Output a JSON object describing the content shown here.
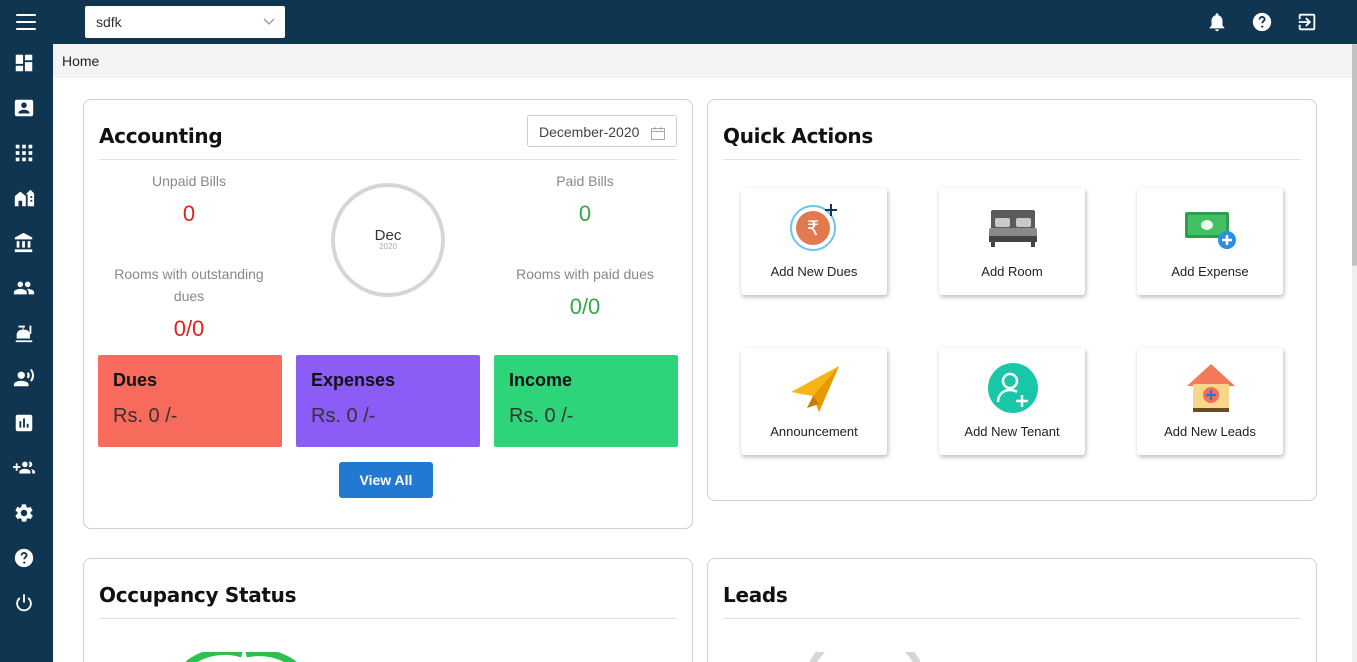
{
  "header": {
    "property_select": {
      "value": "sdfk"
    },
    "icons": [
      "menu-icon",
      "bell-icon",
      "help-icon",
      "logout-icon"
    ]
  },
  "sidebar": {
    "items": [
      {
        "icon": "dashboard-icon"
      },
      {
        "icon": "contact-card-icon"
      },
      {
        "icon": "apps-grid-icon"
      },
      {
        "icon": "building-icon"
      },
      {
        "icon": "bank-icon"
      },
      {
        "icon": "people-icon"
      },
      {
        "icon": "restaurant-icon"
      },
      {
        "icon": "voice-person-icon"
      },
      {
        "icon": "bar-chart-icon"
      },
      {
        "icon": "group-add-icon"
      },
      {
        "icon": "gear-icon"
      },
      {
        "icon": "help-icon"
      },
      {
        "icon": "power-icon"
      }
    ]
  },
  "breadcrumb": {
    "label": "Home"
  },
  "accounting": {
    "title": "Accounting",
    "month_picker": {
      "value": "December-2020"
    },
    "unpaid_bills": {
      "label": "Unpaid Bills",
      "value": "0"
    },
    "paid_bills": {
      "label": "Paid Bills",
      "value": "0"
    },
    "rooms_outstanding": {
      "label": "Rooms with outstanding dues",
      "value": "0/0"
    },
    "rooms_paid": {
      "label": "Rooms with paid dues",
      "value": "0/0"
    },
    "donut": {
      "month": "Dec",
      "year": "2020"
    },
    "boxes": [
      {
        "title": "Dues",
        "amount": "Rs. 0 /-",
        "color": "#f76a5c"
      },
      {
        "title": "Expenses",
        "amount": "Rs. 0 /-",
        "color": "#8b5cf6"
      },
      {
        "title": "Income",
        "amount": "Rs. 0 /-",
        "color": "#2ed47a"
      }
    ],
    "view_all_label": "View All"
  },
  "quick_actions": {
    "title": "Quick Actions",
    "items": [
      {
        "label": "Add New Dues",
        "icon": "rupee-add-icon"
      },
      {
        "label": "Add Room",
        "icon": "bed-icon"
      },
      {
        "label": "Add Expense",
        "icon": "cash-add-icon"
      },
      {
        "label": "Announcement",
        "icon": "paper-plane-icon"
      },
      {
        "label": "Add New Tenant",
        "icon": "person-add-icon"
      },
      {
        "label": "Add New Leads",
        "icon": "house-add-icon"
      }
    ]
  },
  "occupancy": {
    "title": "Occupancy Status"
  },
  "leads": {
    "title": "Leads"
  },
  "colors": {
    "navbar": "#0f3550",
    "red_value": "#e0201f",
    "green_value": "#3aa64a",
    "primary_button": "#2179d2"
  }
}
